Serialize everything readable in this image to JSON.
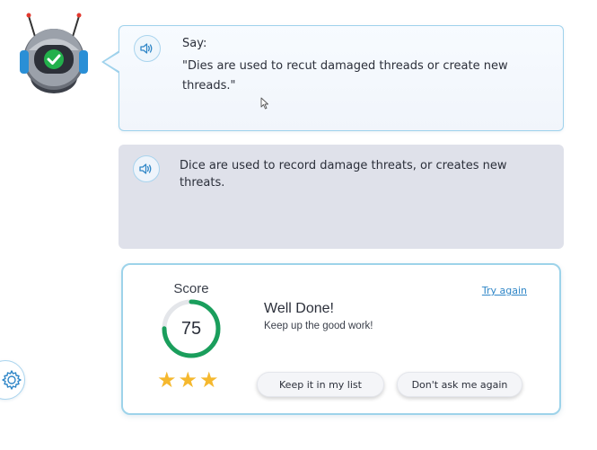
{
  "prompt": {
    "say_label": "Say:",
    "say_text": "\"Dies are used to recut damaged threads or create new threads.\""
  },
  "answer": {
    "text": "Dice are used to record damage threats, or creates new threats."
  },
  "score": {
    "label": "Score",
    "value": "75",
    "progress_fraction": 0.75,
    "stars": 3,
    "title": "Well Done!",
    "subtitle": "Keep up the good work!",
    "try_again": "Try again",
    "keep_button": "Keep it in my list",
    "dont_ask_button": "Don't ask me again"
  },
  "colors": {
    "accent": "#2f86c7",
    "ring": "#1a9e5c",
    "star": "#f5b82e",
    "check": "#22b04b"
  },
  "icons": {
    "avatar": "robot-icon",
    "audio": "speaker-icon",
    "settings": "gear-icon"
  }
}
